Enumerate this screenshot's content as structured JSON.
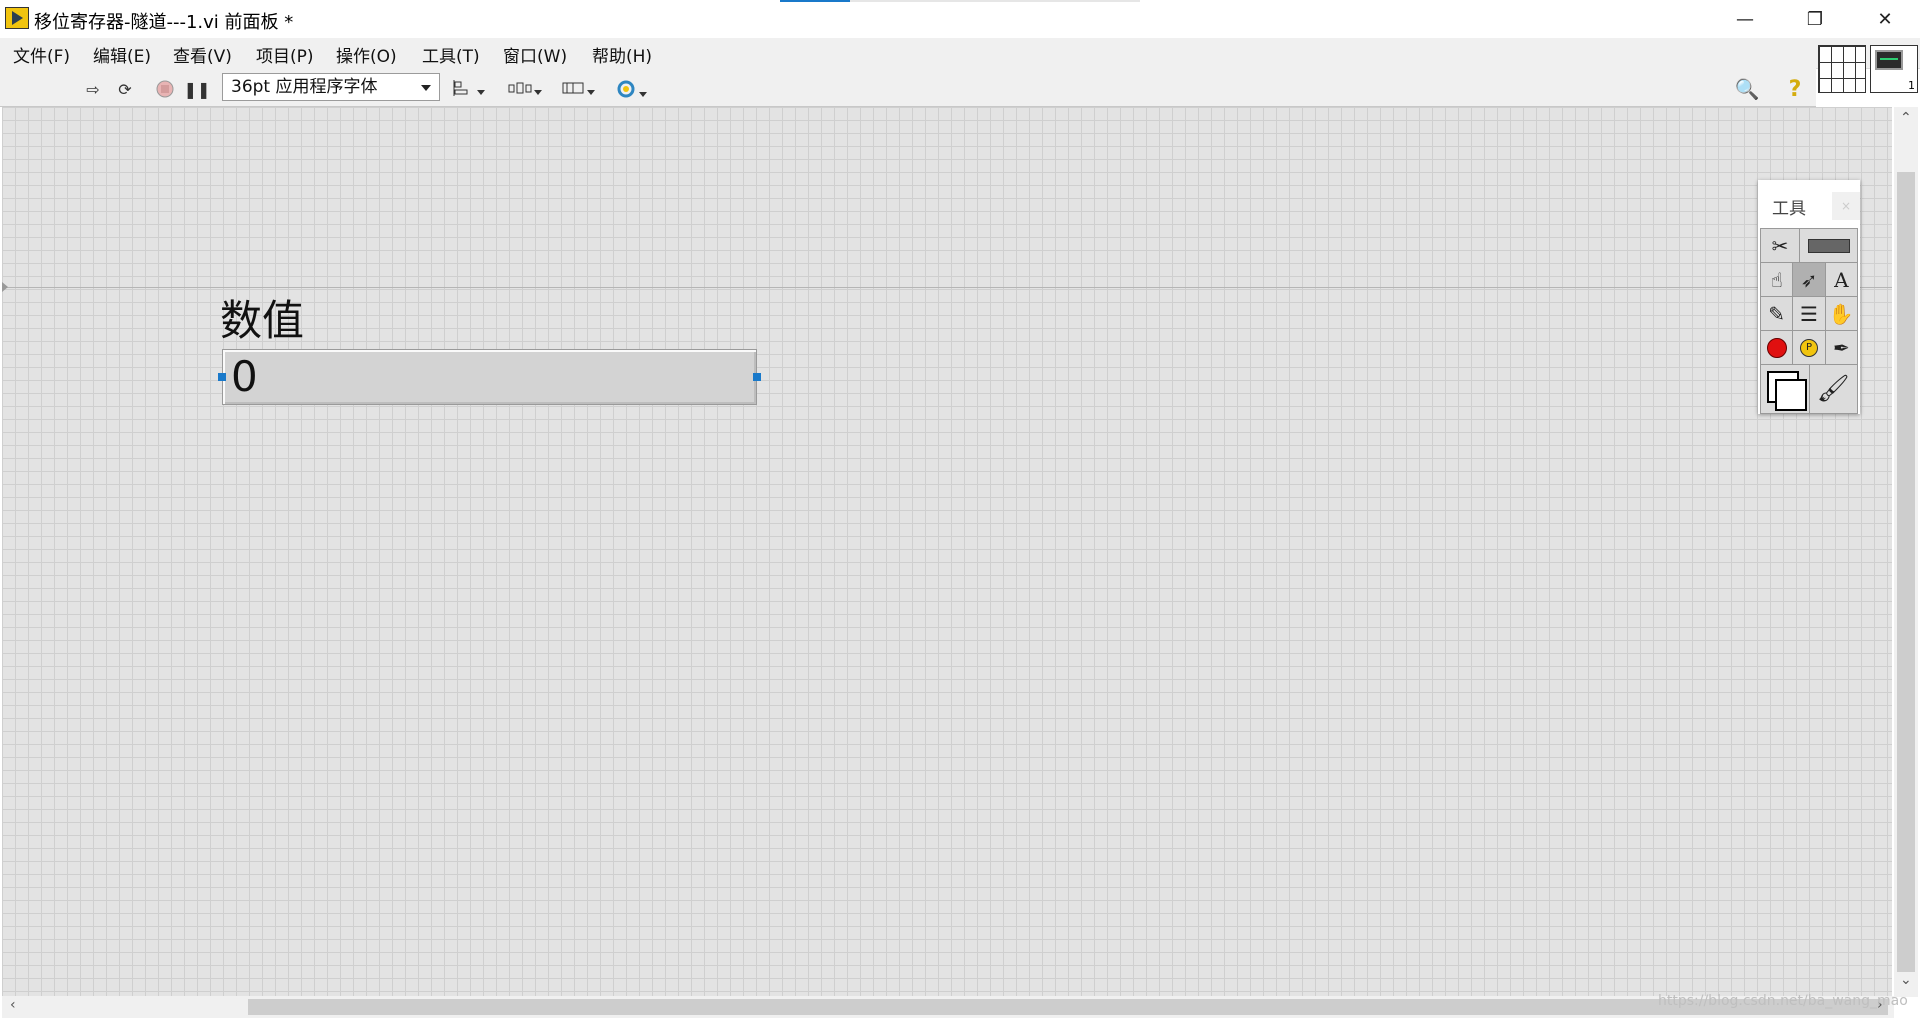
{
  "window": {
    "title": "移位寄存器-隧道---1.vi 前面板 *",
    "minimize_glyph": "—",
    "maximize_glyph": "❐",
    "close_glyph": "✕"
  },
  "menu": {
    "items": [
      "文件(F)",
      "编辑(E)",
      "查看(V)",
      "项目(P)",
      "操作(O)",
      "工具(T)",
      "窗口(W)",
      "帮助(H)"
    ]
  },
  "toolbar": {
    "font_select": "36pt 应用程序字体",
    "icons": [
      "run-arrow-icon",
      "run-continuously-icon",
      "abort-icon",
      "pause-icon",
      "align-objects-icon",
      "distribute-objects-icon",
      "resize-objects-icon",
      "reorder-icon",
      "search-icon",
      "help-icon"
    ]
  },
  "connector": {
    "vi_icon_number": "1"
  },
  "front_panel": {
    "numeric_label": "数值",
    "numeric_value": "0"
  },
  "tools_palette": {
    "title": "工具",
    "close_glyph": "×"
  },
  "watermark": "https://blog.csdn.net/ba_wang_mao"
}
